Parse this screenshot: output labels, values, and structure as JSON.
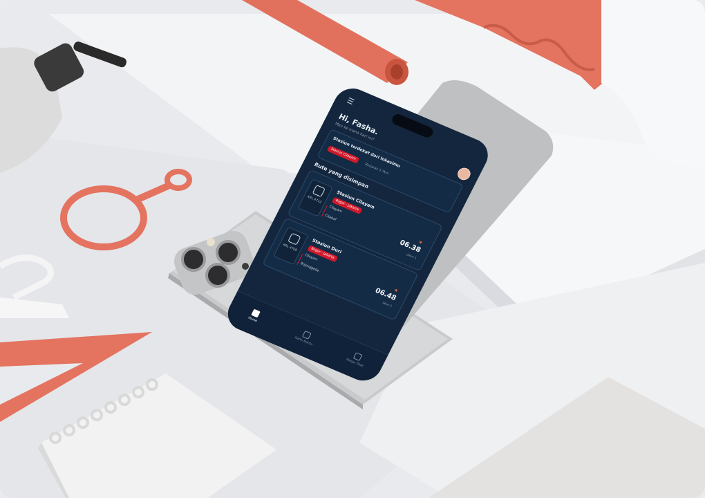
{
  "app": {
    "menu_icon": "hamburger-menu-icon",
    "greeting": "Hi, Fasha.",
    "subtitle": "Mau ke mana hari ini?",
    "nearest": {
      "title": "Stasiun terdekat dari lokasimu",
      "station_tag": "Stasiun Cilayam",
      "distance": "Berjarak 3.7km"
    },
    "saved_title": "Rute yang disimpan",
    "routes": [
      {
        "train_code": "KRL 4712",
        "station": "Stasiun Cilayam",
        "line_tag": "Bogor - Jakarta",
        "stops": [
          "Cilayam",
          "Citabaf"
        ],
        "time": "06.38",
        "track": "Jalur 1"
      },
      {
        "train_code": "KRL 4708",
        "station": "Stasiun Duri",
        "line_tag": "Bogor - Jakarta",
        "stops": [
          "Cilayam",
          "Bojonggede"
        ],
        "time": "06.48",
        "track": "Jalur 1"
      }
    ],
    "nav": [
      "Home",
      "Kartu Bantu",
      "Harga Tiket"
    ]
  },
  "colors": {
    "screen_bg": "#13263d",
    "accent_red": "#d1192b",
    "coral": "#e4735f"
  }
}
